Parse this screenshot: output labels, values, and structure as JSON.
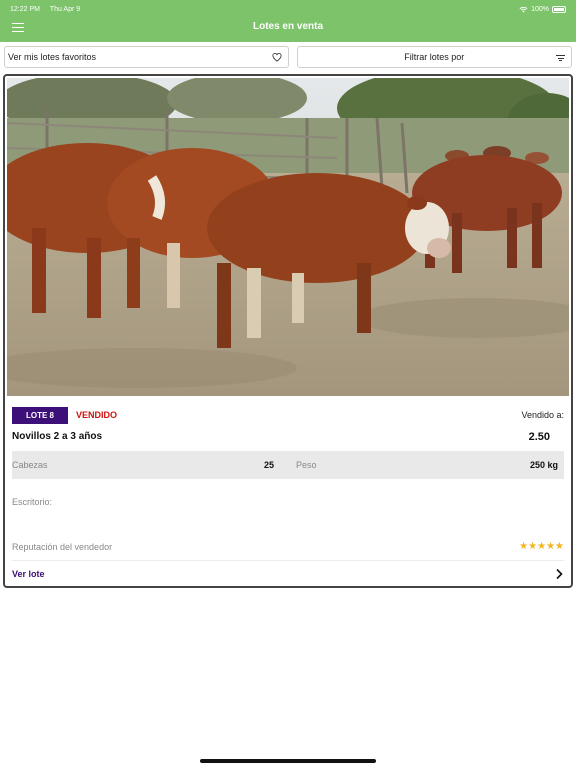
{
  "status_bar": {
    "time": "12:22 PM",
    "date": "Thu Apr 9",
    "battery": "100%"
  },
  "header": {
    "title": "Lotes en venta"
  },
  "filters": {
    "favorites_label": "Ver mis lotes favoritos",
    "filter_label": "Filtrar lotes por"
  },
  "lot": {
    "badge": "LOTE 8",
    "status": "VENDIDO",
    "sold_to_label": "Vendido a:",
    "name": "Novillos 2 a 3 años",
    "price": "2.50",
    "heads_label": "Cabezas",
    "heads_value": "25",
    "weight_label": "Peso",
    "weight_value": "250 kg",
    "office_label": "Escritorio:",
    "reputation_label": "Reputación del vendedor",
    "rating": 5,
    "stars": "★★★★★",
    "view_label": "Ver lote"
  },
  "colors": {
    "header_bg": "#7cc36a",
    "badge_bg": "#3d0f78",
    "sold_red": "#d01010",
    "star": "#f2b51d"
  }
}
